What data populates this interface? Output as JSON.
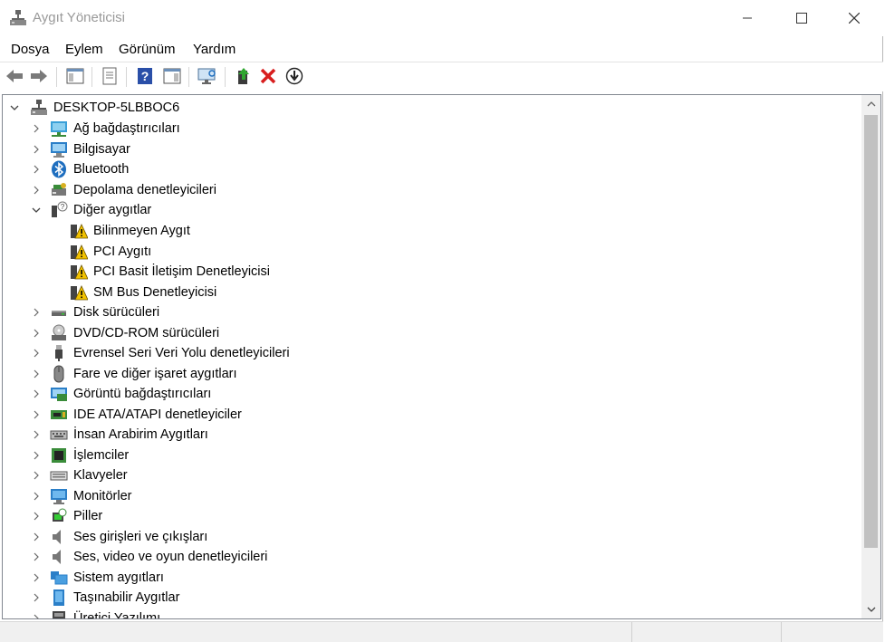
{
  "window": {
    "title": "Aygıt Yöneticisi"
  },
  "menu": [
    "Dosya",
    "Eylem",
    "Görünüm",
    "Yardım"
  ],
  "toolbar": [
    "back-icon",
    "forward-icon",
    "console-tree-icon",
    "properties-icon",
    "help-icon",
    "action-pane-icon",
    "scan-hardware-icon",
    "update-driver-icon",
    "uninstall-icon",
    "download-icon"
  ],
  "tree": {
    "root": "DESKTOP-5LBBOC6",
    "categories": [
      {
        "label": "Ağ bağdaştırıcıları",
        "icon": "network-adapter-icon"
      },
      {
        "label": "Bilgisayar",
        "icon": "computer-icon"
      },
      {
        "label": "Bluetooth",
        "icon": "bluetooth-icon"
      },
      {
        "label": "Depolama denetleyicileri",
        "icon": "storage-controller-icon"
      },
      {
        "label": "Diğer aygıtlar",
        "icon": "other-devices-icon",
        "expanded": true,
        "children": [
          "Bilinmeyen Aygıt",
          "PCI Aygıtı",
          "PCI Basit İletişim Denetleyicisi",
          "SM Bus Denetleyicisi"
        ]
      },
      {
        "label": "Disk sürücüleri",
        "icon": "disk-drive-icon"
      },
      {
        "label": "DVD/CD-ROM sürücüleri",
        "icon": "dvd-drive-icon"
      },
      {
        "label": "Evrensel Seri Veri Yolu denetleyicileri",
        "icon": "usb-controller-icon"
      },
      {
        "label": "Fare ve diğer işaret aygıtları",
        "icon": "mouse-icon"
      },
      {
        "label": "Görüntü bağdaştırıcıları",
        "icon": "display-adapter-icon"
      },
      {
        "label": "IDE ATA/ATAPI denetleyiciler",
        "icon": "ide-controller-icon"
      },
      {
        "label": "İnsan Arabirim Aygıtları",
        "icon": "hid-icon"
      },
      {
        "label": "İşlemciler",
        "icon": "processor-icon"
      },
      {
        "label": "Klavyeler",
        "icon": "keyboard-icon"
      },
      {
        "label": "Monitörler",
        "icon": "monitor-icon"
      },
      {
        "label": "Piller",
        "icon": "battery-icon"
      },
      {
        "label": "Ses girişleri ve çıkışları",
        "icon": "audio-io-icon"
      },
      {
        "label": "Ses, video ve oyun denetleyicileri",
        "icon": "sound-controller-icon"
      },
      {
        "label": "Sistem aygıtları",
        "icon": "system-devices-icon"
      },
      {
        "label": "Taşınabilir Aygıtlar",
        "icon": "portable-devices-icon"
      },
      {
        "label": "Üretici Yazılımı",
        "icon": "firmware-icon"
      }
    ]
  },
  "colors": {
    "accent": "#1e6ebf",
    "warning": "#f2c200",
    "error": "#d81e1e"
  }
}
